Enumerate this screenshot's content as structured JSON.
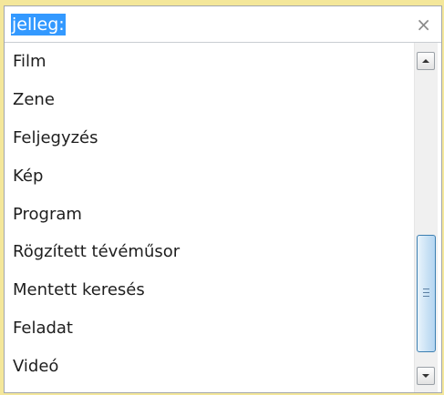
{
  "search": {
    "value": "jelleg:",
    "clear_icon": "×"
  },
  "list": {
    "items": [
      {
        "label": "Film"
      },
      {
        "label": "Zene"
      },
      {
        "label": "Feljegyzés"
      },
      {
        "label": "Kép"
      },
      {
        "label": "Program"
      },
      {
        "label": "Rögzített tévéműsor"
      },
      {
        "label": "Mentett keresés"
      },
      {
        "label": "Feladat"
      },
      {
        "label": "Videó"
      }
    ]
  },
  "scrollbar": {
    "position_fraction": 0.72
  },
  "colors": {
    "selection": "#3399ff",
    "thumb_border": "#3c7fb1",
    "background_strip": "#f4e79a"
  }
}
